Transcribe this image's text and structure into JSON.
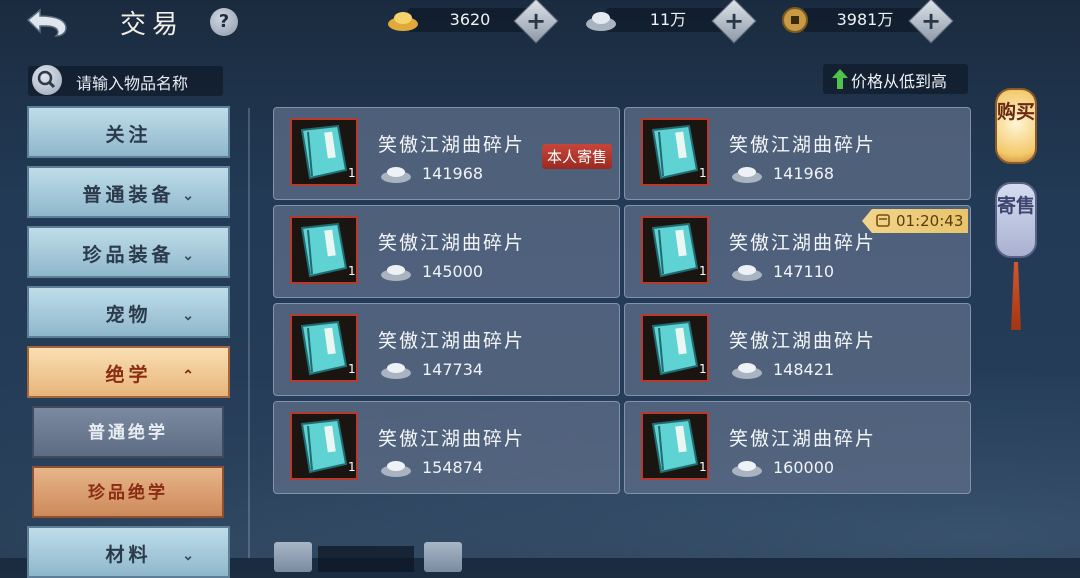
{
  "header": {
    "title": "交易",
    "help_symbol": "?"
  },
  "currencies": [
    {
      "icon": "gold-ingot-icon",
      "amount": "3620"
    },
    {
      "icon": "silver-ingot-icon",
      "amount": "11万"
    },
    {
      "icon": "copper-coin-icon",
      "amount": "3981万"
    }
  ],
  "search": {
    "placeholder": "请输入物品名称"
  },
  "sort": {
    "label": "价格从低到高"
  },
  "sidebar": {
    "items": [
      {
        "label": "关注",
        "chevron": ""
      },
      {
        "label": "普通装备",
        "chevron": "⌄"
      },
      {
        "label": "珍品装备",
        "chevron": "⌄"
      },
      {
        "label": "宠物",
        "chevron": "⌄"
      },
      {
        "label": "绝学",
        "chevron": "⌃"
      },
      {
        "label": "材料",
        "chevron": "⌄"
      }
    ],
    "subitems": [
      {
        "label": "普通绝学"
      },
      {
        "label": "珍品绝学"
      }
    ]
  },
  "listings": [
    {
      "name": "笑傲江湖曲碎片",
      "qty": "1",
      "price": "141968",
      "tag": "本人寄售"
    },
    {
      "name": "笑傲江湖曲碎片",
      "qty": "1",
      "price": "141968"
    },
    {
      "name": "笑傲江湖曲碎片",
      "qty": "1",
      "price": "145000"
    },
    {
      "name": "笑傲江湖曲碎片",
      "qty": "1",
      "price": "147110",
      "timer": "01:20:43"
    },
    {
      "name": "笑傲江湖曲碎片",
      "qty": "1",
      "price": "147734"
    },
    {
      "name": "笑傲江湖曲碎片",
      "qty": "1",
      "price": "148421"
    },
    {
      "name": "笑傲江湖曲碎片",
      "qty": "1",
      "price": "154874"
    },
    {
      "name": "笑傲江湖曲碎片",
      "qty": "1",
      "price": "160000"
    }
  ],
  "right_tabs": {
    "buy": "购买",
    "sell": "寄售"
  },
  "colors": {
    "accent_gold": "#f3c86a",
    "tag_red": "#c8453a",
    "card_bg": "#5c6c87"
  }
}
